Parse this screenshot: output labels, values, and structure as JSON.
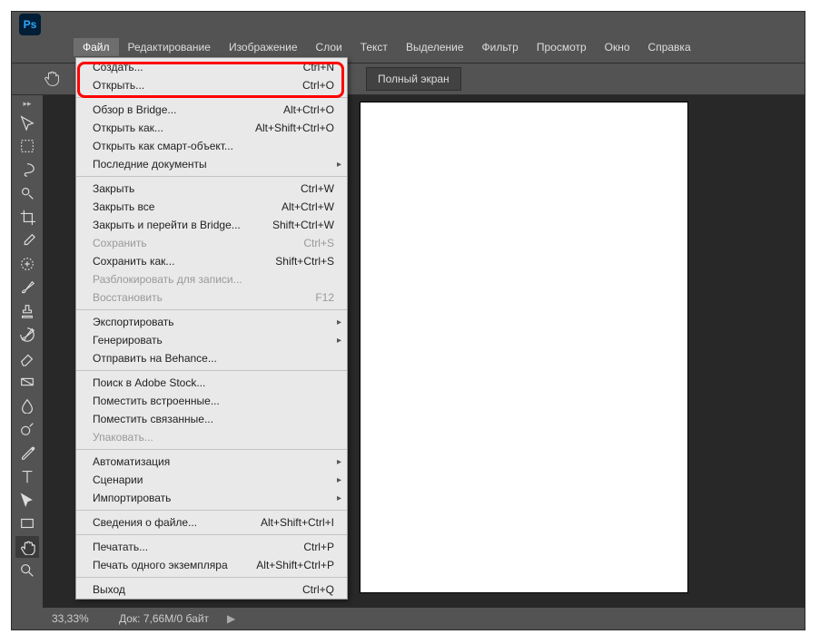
{
  "ps_label": "Ps",
  "menubar": [
    "Файл",
    "Редактирование",
    "Изображение",
    "Слои",
    "Текст",
    "Выделение",
    "Фильтр",
    "Просмотр",
    "Окно",
    "Справка"
  ],
  "optionsbar": {
    "fullscreen_label": "Полный экран"
  },
  "dropdown": {
    "rows": [
      {
        "label": "Создать...",
        "short": "Ctrl+N",
        "disabled": false
      },
      {
        "label": "Открыть...",
        "short": "Ctrl+O",
        "disabled": false
      },
      {
        "type": "sep"
      },
      {
        "label": "Обзор в Bridge...",
        "short": "Alt+Ctrl+O",
        "disabled": false
      },
      {
        "label": "Открыть как...",
        "short": "Alt+Shift+Ctrl+O",
        "disabled": false
      },
      {
        "label": "Открыть как смарт-объект...",
        "short": "",
        "disabled": false
      },
      {
        "label": "Последние документы",
        "short": "",
        "disabled": false,
        "sub": true
      },
      {
        "type": "sep"
      },
      {
        "label": "Закрыть",
        "short": "Ctrl+W",
        "disabled": false
      },
      {
        "label": "Закрыть все",
        "short": "Alt+Ctrl+W",
        "disabled": false
      },
      {
        "label": "Закрыть и перейти в Bridge...",
        "short": "Shift+Ctrl+W",
        "disabled": false
      },
      {
        "label": "Сохранить",
        "short": "Ctrl+S",
        "disabled": true
      },
      {
        "label": "Сохранить как...",
        "short": "Shift+Ctrl+S",
        "disabled": false
      },
      {
        "label": "Разблокировать для записи...",
        "short": "",
        "disabled": true
      },
      {
        "label": "Восстановить",
        "short": "F12",
        "disabled": true
      },
      {
        "type": "sep"
      },
      {
        "label": "Экспортировать",
        "short": "",
        "disabled": false,
        "sub": true
      },
      {
        "label": "Генерировать",
        "short": "",
        "disabled": false,
        "sub": true
      },
      {
        "label": "Отправить на Behance...",
        "short": "",
        "disabled": false
      },
      {
        "type": "sep"
      },
      {
        "label": "Поиск в Adobe Stock...",
        "short": "",
        "disabled": false
      },
      {
        "label": "Поместить встроенные...",
        "short": "",
        "disabled": false
      },
      {
        "label": "Поместить связанные...",
        "short": "",
        "disabled": false
      },
      {
        "label": "Упаковать...",
        "short": "",
        "disabled": true
      },
      {
        "type": "sep"
      },
      {
        "label": "Автоматизация",
        "short": "",
        "disabled": false,
        "sub": true
      },
      {
        "label": "Сценарии",
        "short": "",
        "disabled": false,
        "sub": true
      },
      {
        "label": "Импортировать",
        "short": "",
        "disabled": false,
        "sub": true
      },
      {
        "type": "sep"
      },
      {
        "label": "Сведения о файле...",
        "short": "Alt+Shift+Ctrl+I",
        "disabled": false
      },
      {
        "type": "sep"
      },
      {
        "label": "Печатать...",
        "short": "Ctrl+P",
        "disabled": false
      },
      {
        "label": "Печать одного экземпляра",
        "short": "Alt+Shift+Ctrl+P",
        "disabled": false
      },
      {
        "type": "sep"
      },
      {
        "label": "Выход",
        "short": "Ctrl+Q",
        "disabled": false
      }
    ]
  },
  "tools": [
    {
      "name": "move-tool"
    },
    {
      "name": "marquee-tool"
    },
    {
      "name": "lasso-tool"
    },
    {
      "name": "quick-select-tool"
    },
    {
      "name": "crop-tool"
    },
    {
      "name": "eyedropper-tool"
    },
    {
      "name": "healing-tool"
    },
    {
      "name": "brush-tool"
    },
    {
      "name": "stamp-tool"
    },
    {
      "name": "history-brush-tool"
    },
    {
      "name": "eraser-tool"
    },
    {
      "name": "gradient-tool"
    },
    {
      "name": "blur-tool"
    },
    {
      "name": "dodge-tool"
    },
    {
      "name": "pen-tool"
    },
    {
      "name": "type-tool"
    },
    {
      "name": "path-select-tool"
    },
    {
      "name": "rectangle-tool"
    },
    {
      "name": "hand-tool",
      "active": true
    },
    {
      "name": "zoom-tool"
    }
  ],
  "statusbar": {
    "zoom": "33,33%",
    "doc": "Док: 7,66M/0 байт",
    "chev": "▶"
  }
}
